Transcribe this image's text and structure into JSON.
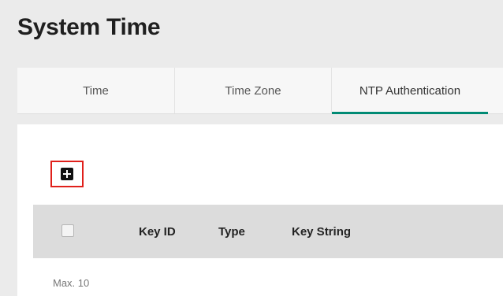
{
  "page": {
    "title": "System Time"
  },
  "tabs": [
    {
      "label": "Time",
      "active": false
    },
    {
      "label": "Time Zone",
      "active": false
    },
    {
      "label": "NTP Authentication",
      "active": true
    }
  ],
  "toolbar": {
    "add_icon": "plus-square-icon"
  },
  "table": {
    "columns": [
      "Key ID",
      "Type",
      "Key String"
    ],
    "rows": []
  },
  "footer": {
    "max_label": "Max. 10"
  },
  "colors": {
    "accent": "#008a74",
    "highlight": "#e0201b",
    "header_bg": "#dcdcdc"
  }
}
